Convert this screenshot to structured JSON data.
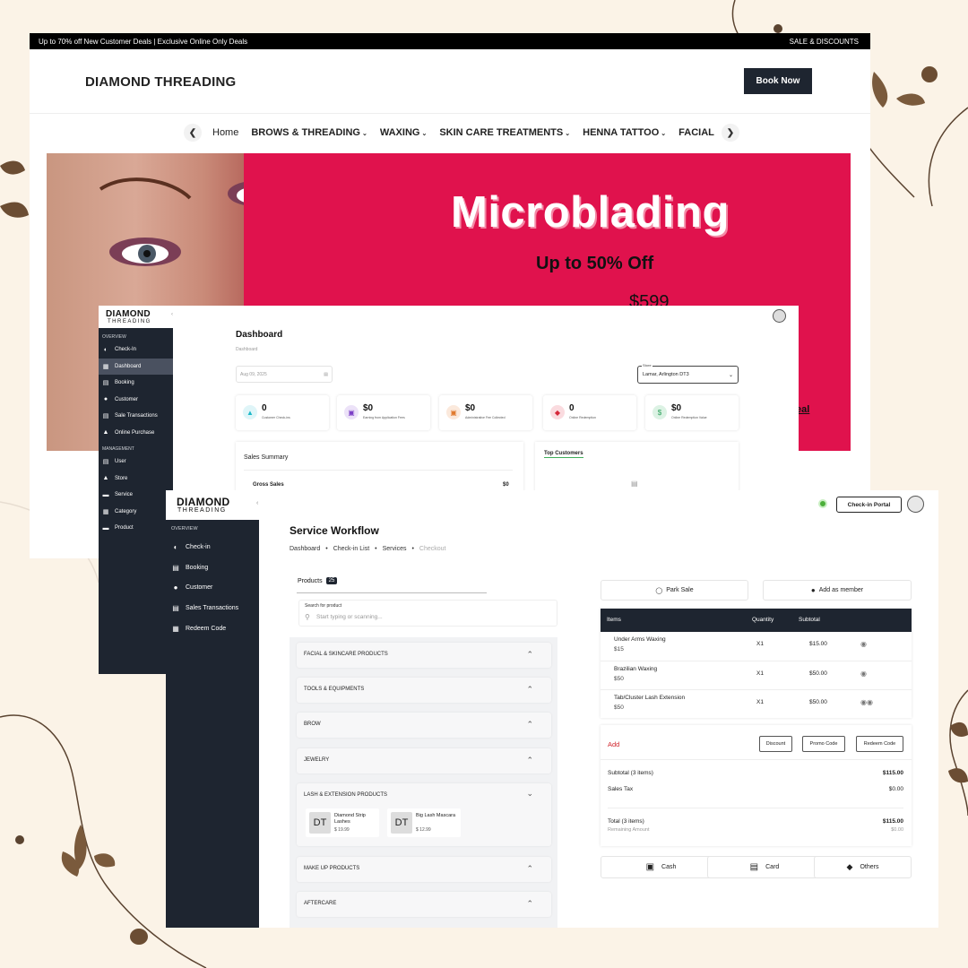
{
  "website": {
    "promo_text": "Up to 70% off New Customer Deals | Exclusive Online Only Deals",
    "sale_link": "SALE & DISCOUNTS",
    "logo": "DIAMOND THREADING",
    "book_button": "Book Now",
    "nav_items": [
      "Home",
      "BROWS & THREADING",
      "WAXING",
      "SKIN CARE TREATMENTS",
      "HENNA TATTOO",
      "FACIAL"
    ],
    "hero": {
      "title": "Microblading",
      "subtitle": "Up to 50% Off",
      "price": "$599",
      "link": "eal"
    }
  },
  "dashboard": {
    "logo_main": "DIAMOND",
    "logo_sub": "THREADING",
    "sections": {
      "overview": "OVERVIEW",
      "management": "MANAGEMENT"
    },
    "overview_items": [
      {
        "label": "Check-In",
        "icon": "checkin-icon"
      },
      {
        "label": "Dashboard",
        "icon": "dashboard-icon"
      },
      {
        "label": "Booking",
        "icon": "booking-icon"
      },
      {
        "label": "Customer",
        "icon": "customer-icon"
      },
      {
        "label": "Sale Transactions",
        "icon": "transactions-icon"
      },
      {
        "label": "Online Purchase",
        "icon": "cart-icon"
      }
    ],
    "management_items": [
      {
        "label": "User",
        "icon": "user-icon"
      },
      {
        "label": "Store",
        "icon": "store-icon"
      },
      {
        "label": "Service",
        "icon": "folder-icon"
      },
      {
        "label": "Category",
        "icon": "category-icon"
      },
      {
        "label": "Product",
        "icon": "folder-icon"
      }
    ],
    "title": "Dashboard",
    "breadcrumb": "Dashboard",
    "date": "Aug 09, 2025",
    "store_label": "Store",
    "store_value": "Lamar, Arlington DT3",
    "stats": [
      {
        "value": "0",
        "label": "Customer Check-ins",
        "color": "#1bb8c9",
        "bg": "#dff5f8",
        "icon": "cart-icon"
      },
      {
        "value": "$0",
        "label": "Earning from Application Fees",
        "color": "#7b3fc6",
        "bg": "#ece2f8",
        "icon": "bag-icon"
      },
      {
        "value": "$0",
        "label": "Administrative Fee Collected",
        "color": "#e07a2f",
        "bg": "#fbe9dc",
        "icon": "fee-icon"
      },
      {
        "value": "0",
        "label": "Online Redemption",
        "color": "#d6283a",
        "bg": "#fadbdf",
        "icon": "tag-icon"
      },
      {
        "value": "$0",
        "label": "Online Redemption Value",
        "color": "#2ba05a",
        "bg": "#dcf2e4",
        "icon": "money-icon"
      }
    ],
    "sales_summary": {
      "title": "Sales Summary",
      "gross_label": "Gross Sales",
      "gross_value": "$0"
    },
    "top_customers": "Top Customers"
  },
  "workflow": {
    "logo_main": "DIAMOND",
    "logo_sub": "THREADING",
    "section": "OVERVIEW",
    "nav": [
      {
        "label": "Check-in",
        "icon": "checkin-icon"
      },
      {
        "label": "Booking",
        "icon": "booking-icon"
      },
      {
        "label": "Customer",
        "icon": "customer-icon"
      },
      {
        "label": "Sales Transactions",
        "icon": "transactions-icon"
      },
      {
        "label": "Redeem Code",
        "icon": "redeem-icon"
      }
    ],
    "checkin_portal": "Check-in Portal",
    "title": "Service Workflow",
    "breadcrumb": [
      "Dashboard",
      "Check-in List",
      "Services",
      "Checkout"
    ],
    "products_tab": "Products",
    "products_count": "25",
    "search_label": "Search for product",
    "search_placeholder": "Start typing or scanning...",
    "categories": [
      "FACIAL & SKINCARE PRODUCTS",
      "TOOLS & EQUIPMENTS",
      "BROW",
      "JEWELRY",
      "LASH & EXTENSION PRODUCTS",
      "MAKE UP PRODUCTS",
      "AFTERCARE"
    ],
    "lash_products": [
      {
        "badge": "DT",
        "name": "Diamond Strip Lashes",
        "price": "$ 19.99"
      },
      {
        "badge": "DT",
        "name": "Big Lash Mascara",
        "price": "$ 12.99"
      }
    ],
    "park_sale": "Park Sale",
    "add_member": "Add as member",
    "table_headers": {
      "items": "Items",
      "quantity": "Quantity",
      "subtotal": "Subtotal"
    },
    "rows": [
      {
        "name": "Under Arms Waxing",
        "price": "$15",
        "qty": "X1",
        "subtotal": "$15.00"
      },
      {
        "name": "Brazilian Waxing",
        "price": "$50",
        "qty": "X1",
        "subtotal": "$50.00"
      },
      {
        "name": "Tab/Cluster Lash Extension",
        "price": "$50",
        "qty": "X1",
        "subtotal": "$50.00"
      }
    ],
    "add_label": "Add",
    "discount": "Discount",
    "promo_code": "Promo Code",
    "redeem_code": "Redeem Code",
    "subtotal_label": "Subtotal (3 items)",
    "subtotal_value": "$115.00",
    "tax_label": "Sales Tax",
    "tax_value": "$0.00",
    "total_label": "Total (3 items)",
    "total_value": "$115.00",
    "remaining_label": "Remaining Amount",
    "remaining_value": "$0.00",
    "pay_cash": "Cash",
    "pay_card": "Card",
    "pay_others": "Others"
  }
}
